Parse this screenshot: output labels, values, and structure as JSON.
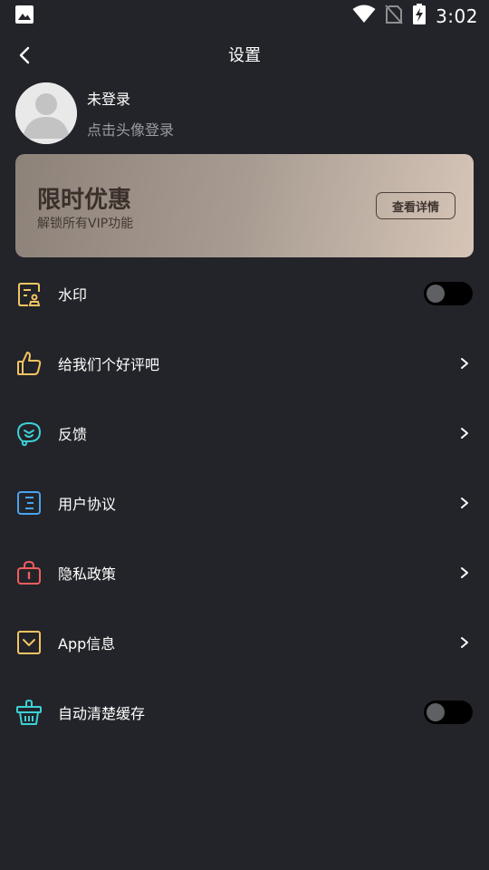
{
  "status_bar": {
    "time": "3:02"
  },
  "header": {
    "title": "设置"
  },
  "profile": {
    "name": "未登录",
    "hint": "点击头像登录"
  },
  "promo": {
    "title": "限时优惠",
    "subtitle": "解锁所有VIP功能",
    "button_label": "查看详情"
  },
  "menu": [
    {
      "label": "水印",
      "icon": "watermark-icon",
      "control": "toggle",
      "enabled": false
    },
    {
      "label": "给我们个好评吧",
      "icon": "thumbs-up-icon",
      "control": "chevron"
    },
    {
      "label": "反馈",
      "icon": "feedback-icon",
      "control": "chevron"
    },
    {
      "label": "用户协议",
      "icon": "document-icon",
      "control": "chevron"
    },
    {
      "label": "隐私政策",
      "icon": "lock-icon",
      "control": "chevron"
    },
    {
      "label": "App信息",
      "icon": "info-box-icon",
      "control": "chevron"
    },
    {
      "label": "自动清楚缓存",
      "icon": "basket-icon",
      "control": "toggle",
      "enabled": false
    }
  ],
  "colors": {
    "background": "#232429",
    "promo_start": "#8d8279",
    "promo_end": "#d6c5b7",
    "icon_yellow": "#f2c462",
    "icon_teal": "#3bd1d6",
    "icon_blue": "#4aa3f0",
    "icon_red": "#ef5d5d"
  }
}
